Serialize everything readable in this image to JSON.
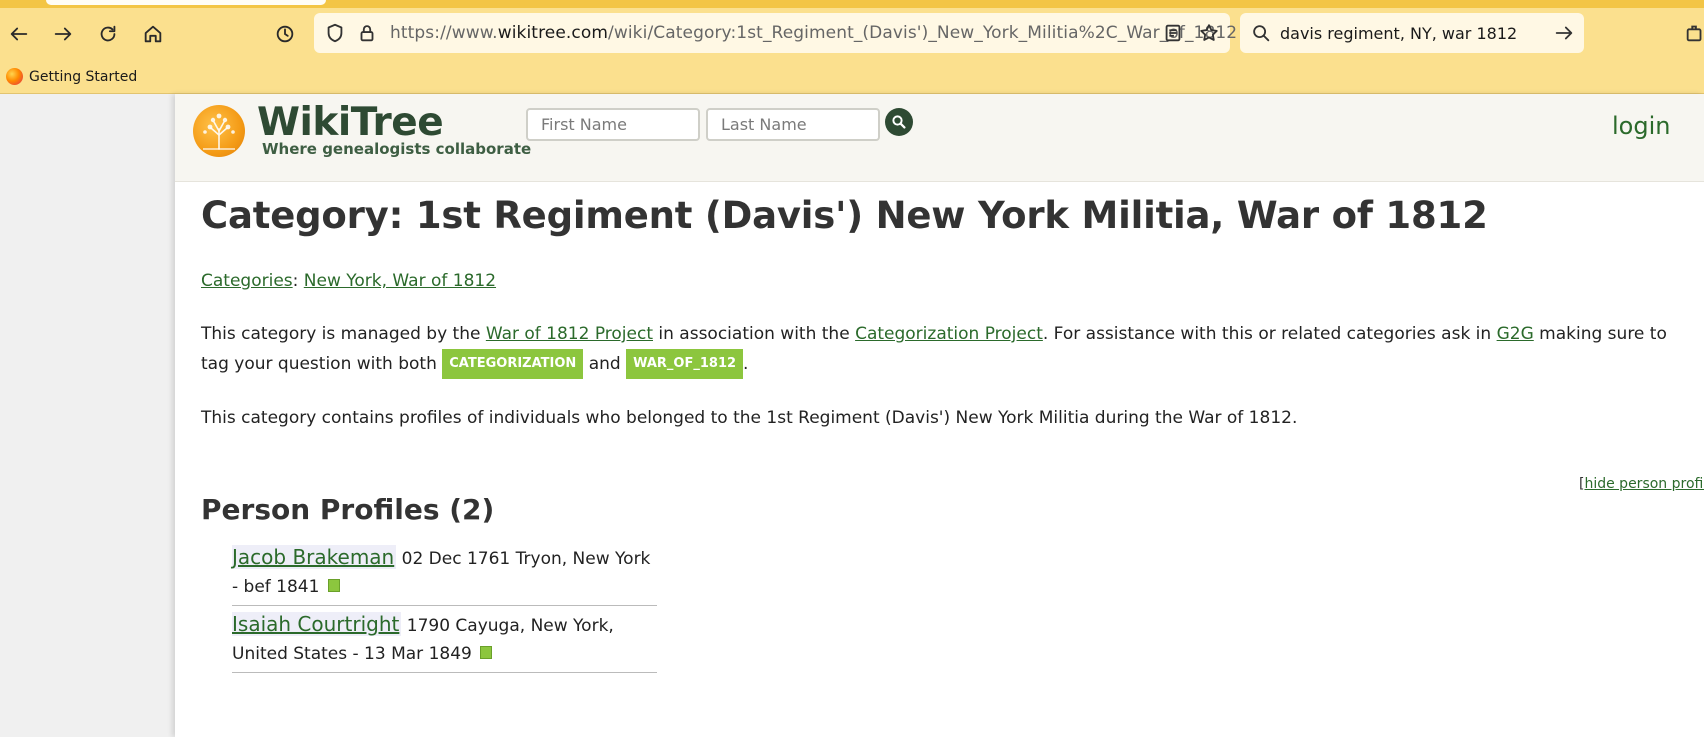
{
  "browser": {
    "url_prefix": "https://www.",
    "url_domain": "wikitree.com",
    "url_path": "/wiki/Category:1st_Regiment_(Davis')_New_York_Militia%2C_War_of_1812",
    "search_query": "davis regiment, NY, war 1812",
    "bookmark_label": "Getting Started",
    "icons": [
      "back-arrow-icon",
      "forward-arrow-icon",
      "reload-icon",
      "home-icon",
      "history-icon",
      "shield-icon",
      "lock-icon",
      "reader-view-icon",
      "bookmark-star-icon",
      "search-icon",
      "go-arrow-icon",
      "extension-icon"
    ]
  },
  "site": {
    "name": "WikiTree",
    "tagline": "Where genealogists collaborate",
    "first_name_placeholder": "First Name",
    "last_name_placeholder": "Last Name",
    "login_label": "login"
  },
  "content": {
    "title": "Category: 1st Regiment (Davis') New York Militia, War of 1812",
    "breadcrumb_root": "Categories",
    "breadcrumb_sep": ":",
    "breadcrumb_parent": "New York, War of 1812",
    "manage_1": "This category is managed by the ",
    "manage_link1": "War of 1812 Project",
    "manage_2": " in association with the ",
    "manage_link2": "Categorization Project",
    "manage_3": ". For assistance with this or related categories ask in ",
    "manage_link3": "G2G",
    "manage_4": " making sure to tag your question with both ",
    "tag1": "CATEGORIZATION",
    "manage_5": " and ",
    "tag2": "WAR_OF_1812",
    "manage_6": ".",
    "contains": "This category contains profiles of individuals who belonged to the 1st Regiment (Davis') New York Militia during the War of 1812.",
    "profiles_heading": "Person Profiles (2)",
    "hide_open": "[",
    "hide_label": "hide person profiles",
    "hide_close": "]",
    "profiles": [
      {
        "name": "Jacob Brakeman",
        "details": "02 Dec 1761 Tryon, New York - bef 1841"
      },
      {
        "name": "Isaiah Courtright",
        "details": "1790 Cayuga, New York, United States - 13 Mar 1849"
      }
    ]
  },
  "colors": {
    "toolbar": "#fbe08e",
    "brand_green": "#2e4a33",
    "link_green": "#2b6a2b",
    "tag_green": "#8cc63e",
    "logo_orange": "#f49b16"
  }
}
